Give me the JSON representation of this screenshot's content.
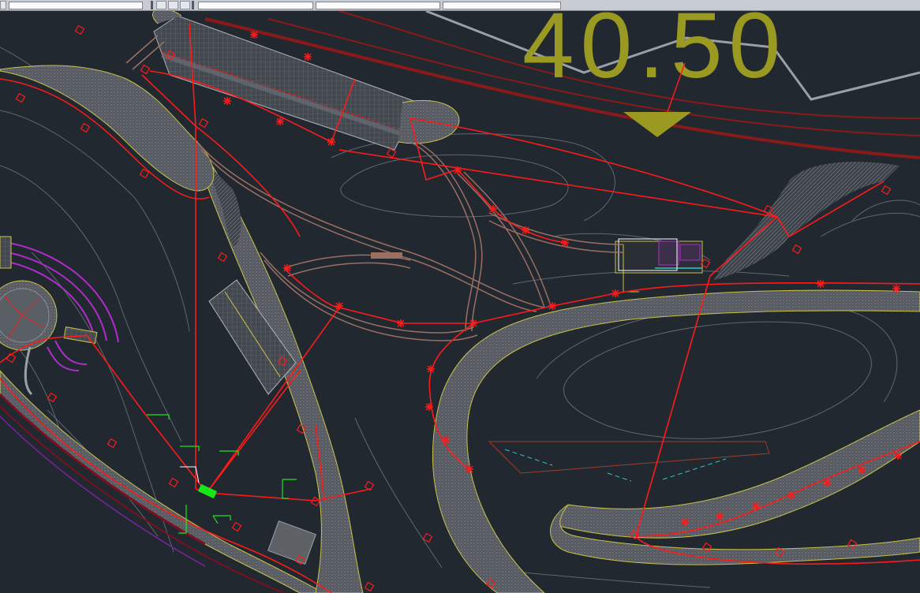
{
  "toolbar": {
    "layer_field": "",
    "color_field": "",
    "linetype_field": "",
    "lineweight_field": ""
  },
  "drawing": {
    "elevation_label": "40.50",
    "colors": {
      "background": "#212830",
      "boundary": "#ff1a1a",
      "road_fill": "#5e6266",
      "road_edge": "#c9c24a",
      "path": "#9c6f63",
      "contour": "#6a7079",
      "elevation_text": "#9a9a22",
      "highlight": "#19e619",
      "hatch": "#4c5057",
      "purple": "#b02cc8",
      "cyan": "#2cc8c8"
    }
  }
}
